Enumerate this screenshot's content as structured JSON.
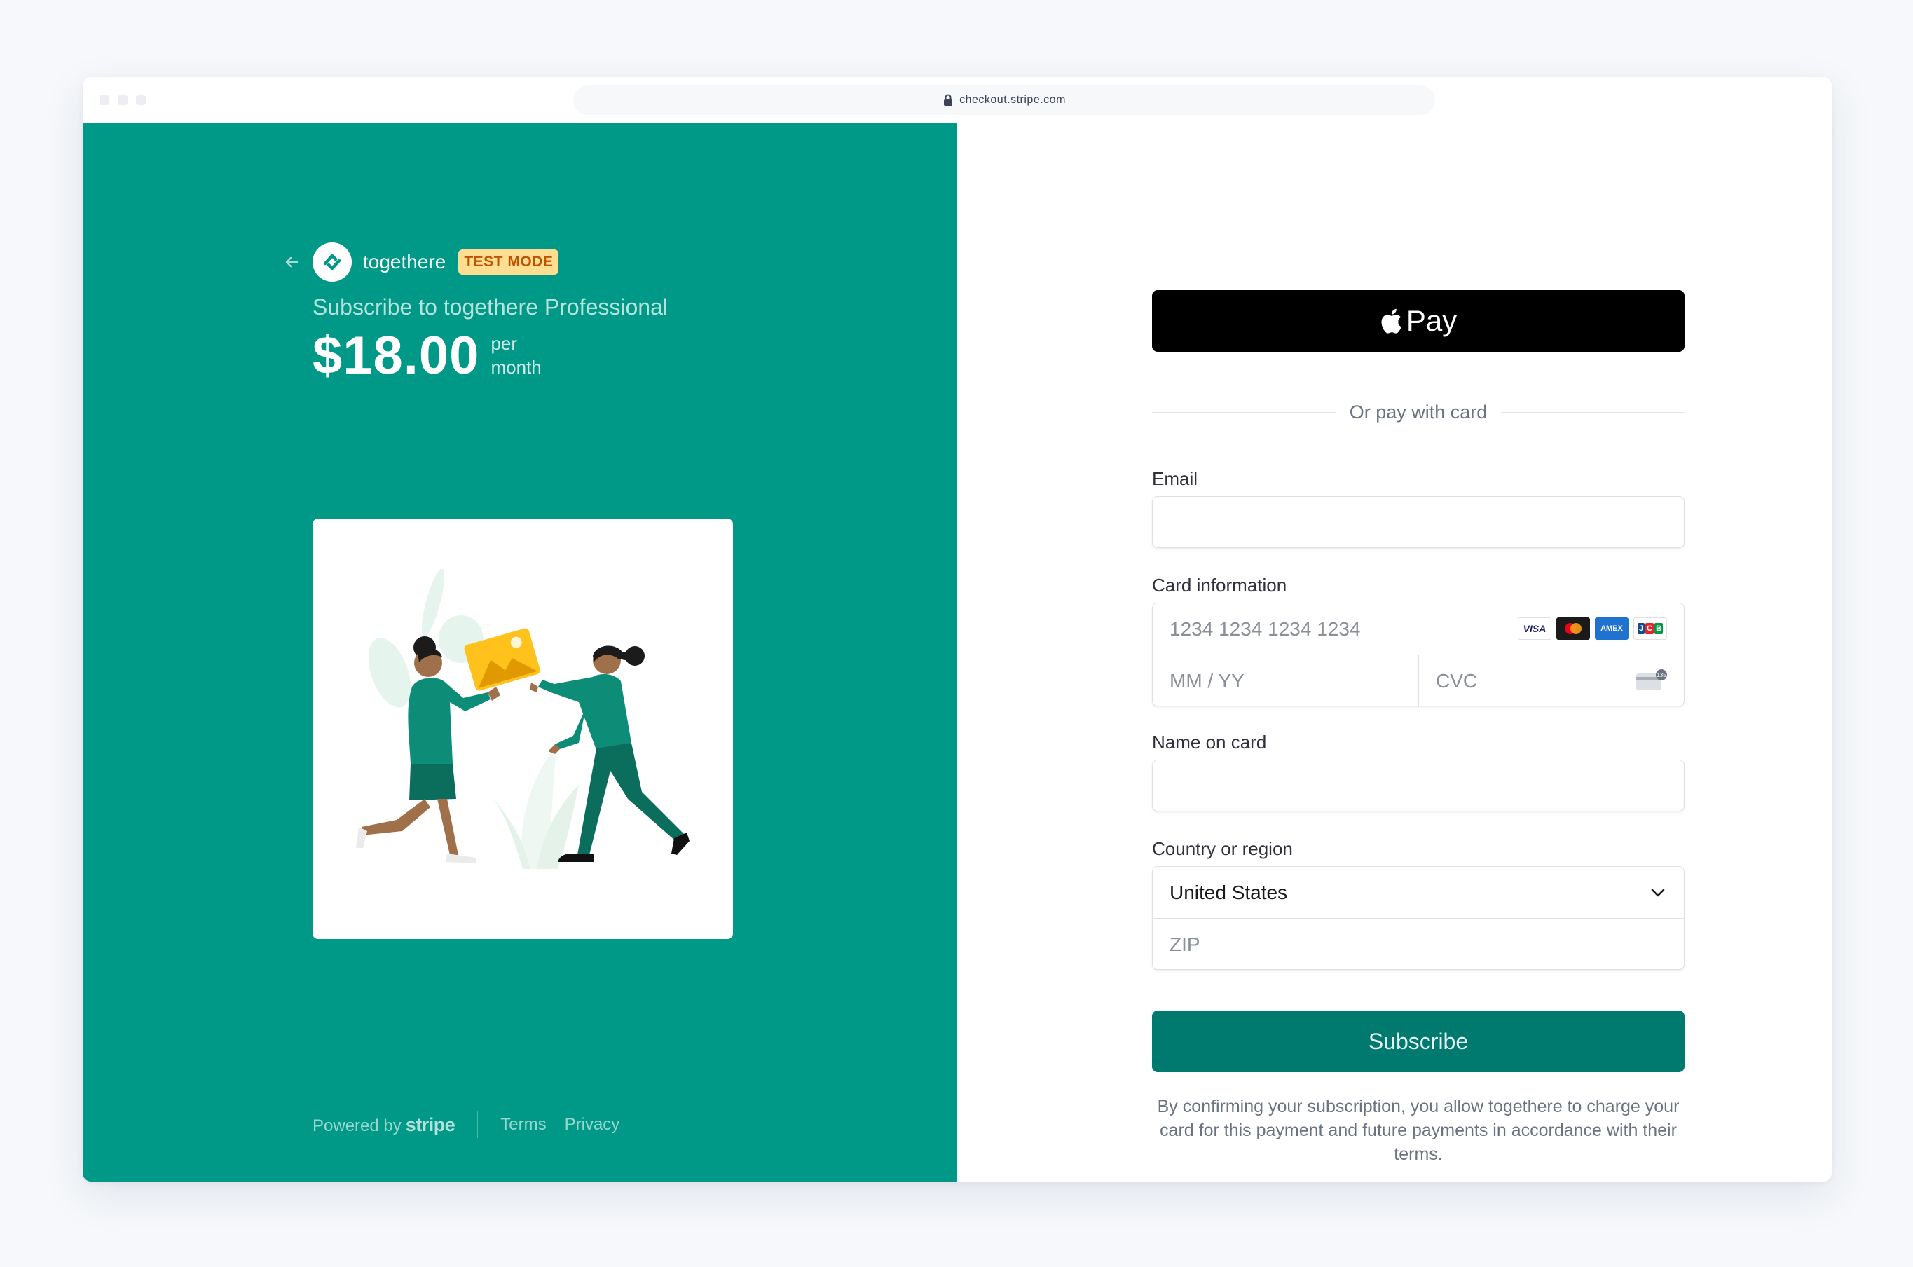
{
  "browser": {
    "url": "checkout.stripe.com"
  },
  "merchant": {
    "name": "togethere",
    "badge": "TEST MODE"
  },
  "summary": {
    "title": "Subscribe to togethere Professional",
    "price": "$18.00",
    "period_line1": "per",
    "period_line2": "month"
  },
  "footer": {
    "powered_by": "Powered by",
    "stripe": "stripe",
    "terms": "Terms",
    "privacy": "Privacy"
  },
  "payment": {
    "apple_pay_label": "Pay",
    "divider_text": "Or pay with card",
    "email_label": "Email",
    "email_value": "",
    "card_label": "Card information",
    "card_number_placeholder": "1234 1234 1234 1234",
    "expiry_placeholder": "MM / YY",
    "cvc_placeholder": "CVC",
    "card_brands": [
      "VISA",
      "mastercard",
      "amex",
      "JCB"
    ],
    "name_label": "Name on card",
    "name_value": "",
    "country_label": "Country or region",
    "country_value": "United States",
    "zip_placeholder": "ZIP",
    "subscribe_label": "Subscribe",
    "terms_text": "By confirming your subscription, you allow togethere to charge your card for this payment and future payments in accordance with their terms."
  },
  "colors": {
    "brand_green": "#009886",
    "subscribe_button": "#007a6e",
    "badge_bg": "#ffde92",
    "badge_text": "#bb5504"
  }
}
